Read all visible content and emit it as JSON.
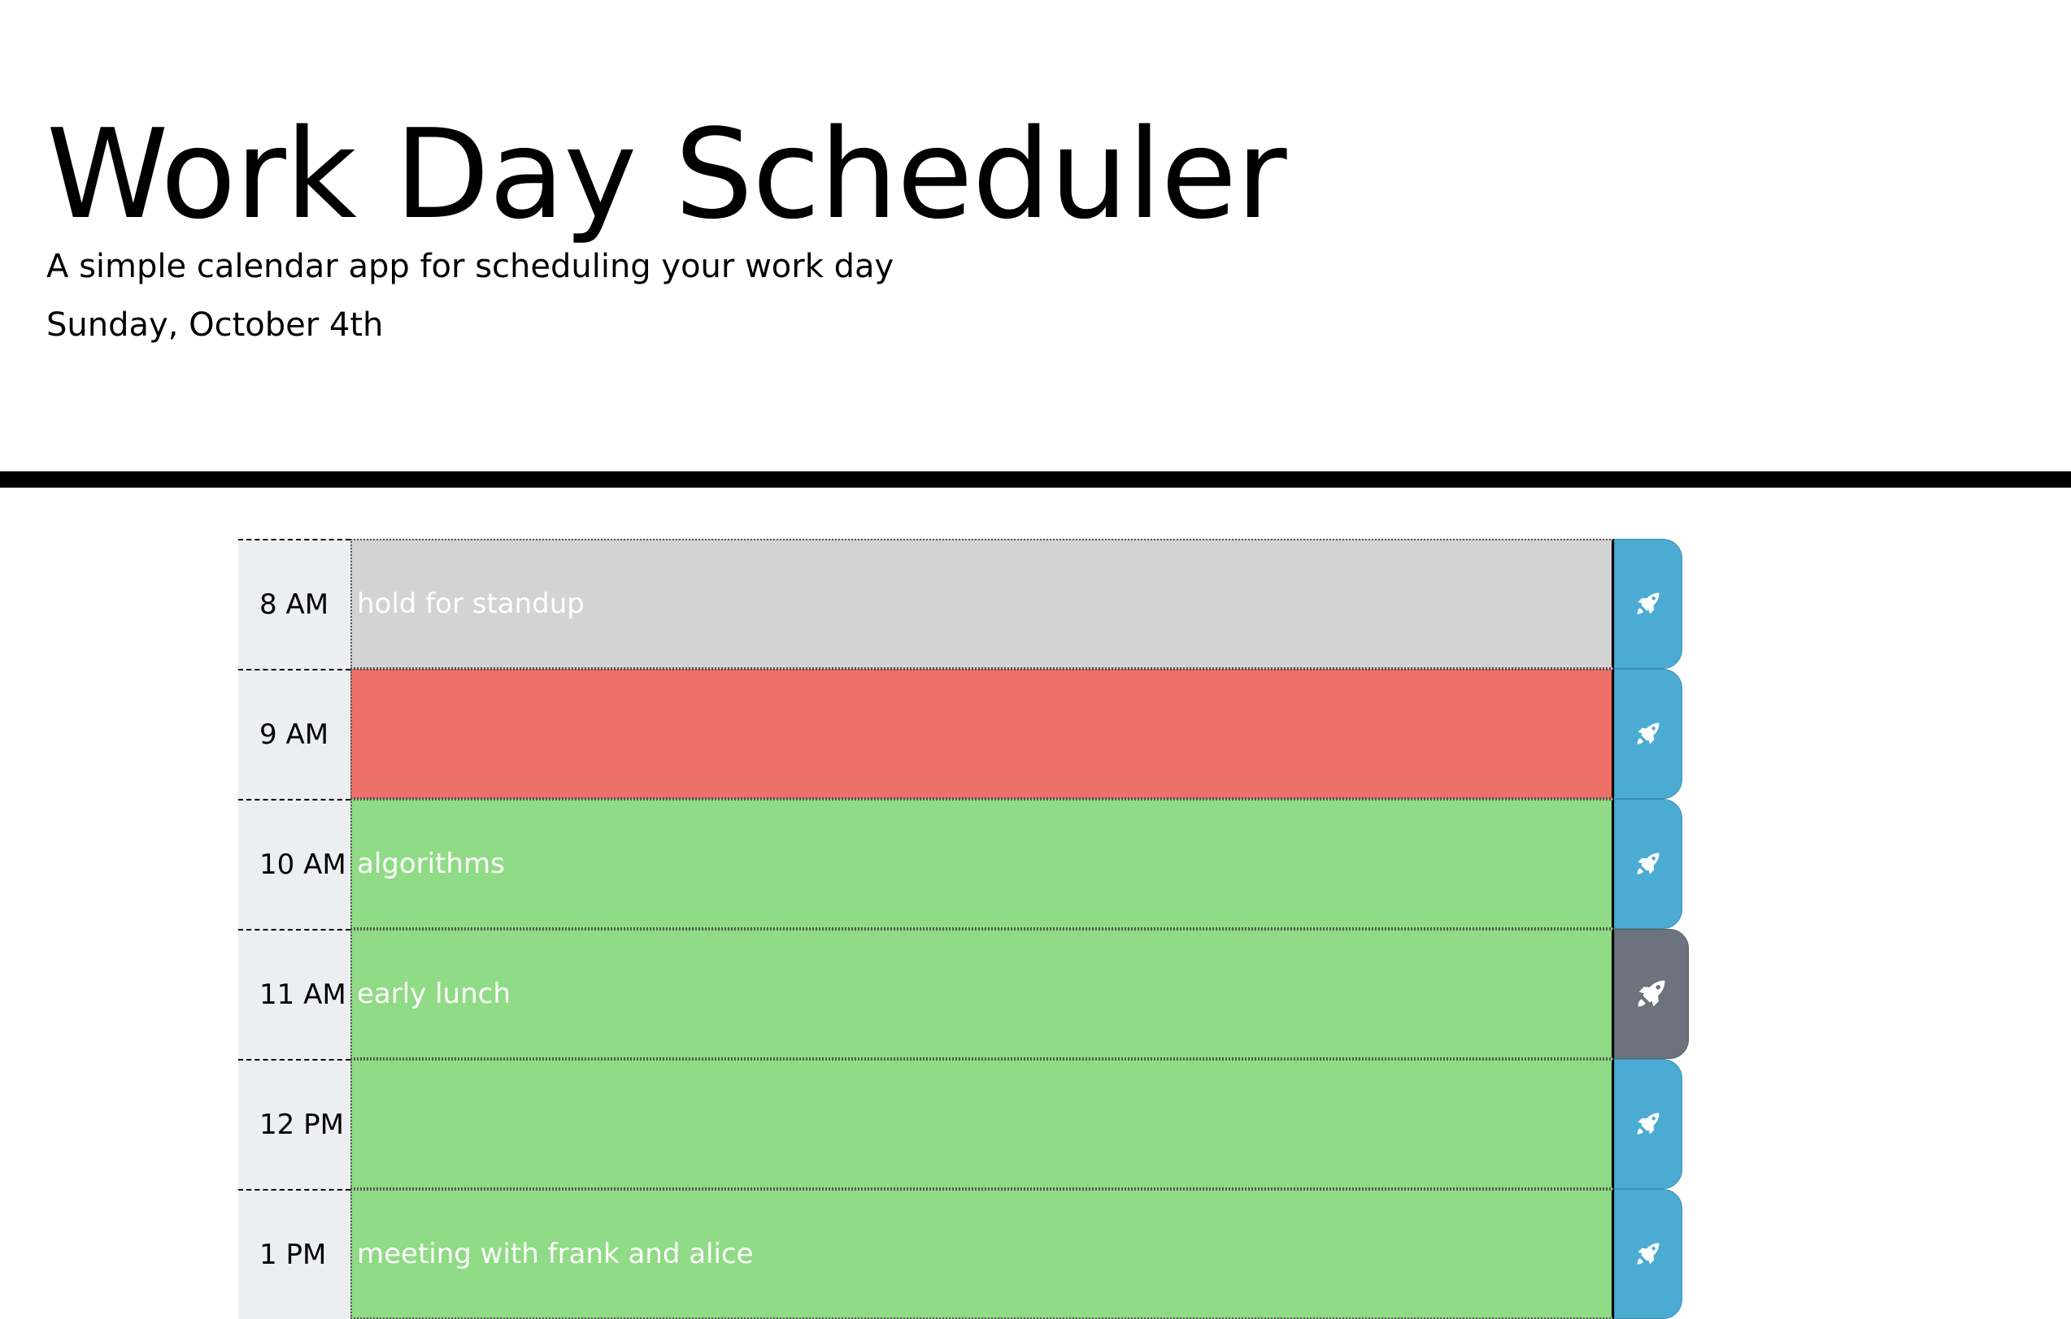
{
  "header": {
    "title": "Work Day Scheduler",
    "lead": "A simple calendar app for scheduling your work day",
    "current_day": "Sunday, October 4th"
  },
  "colors": {
    "past": "#d3d3d3",
    "present": "#ed7168",
    "future": "#90db85",
    "save_button": "#4cabd2",
    "save_button_hover": "#6c737d"
  },
  "timeblocks": [
    {
      "hour": "8 AM",
      "text": "hold for standup",
      "state": "past",
      "save_icon": "rocket-icon"
    },
    {
      "hour": "9 AM",
      "text": "",
      "state": "present",
      "save_icon": "rocket-icon"
    },
    {
      "hour": "10 AM",
      "text": "algorithms",
      "state": "future",
      "save_icon": "rocket-icon"
    },
    {
      "hour": "11 AM",
      "text": "early lunch",
      "state": "future",
      "save_icon": "rocket-icon"
    },
    {
      "hour": "12 PM",
      "text": "",
      "state": "future",
      "save_icon": "rocket-icon"
    },
    {
      "hour": "1 PM",
      "text": "meeting with frank and alice",
      "state": "future",
      "save_icon": "rocket-icon"
    }
  ]
}
